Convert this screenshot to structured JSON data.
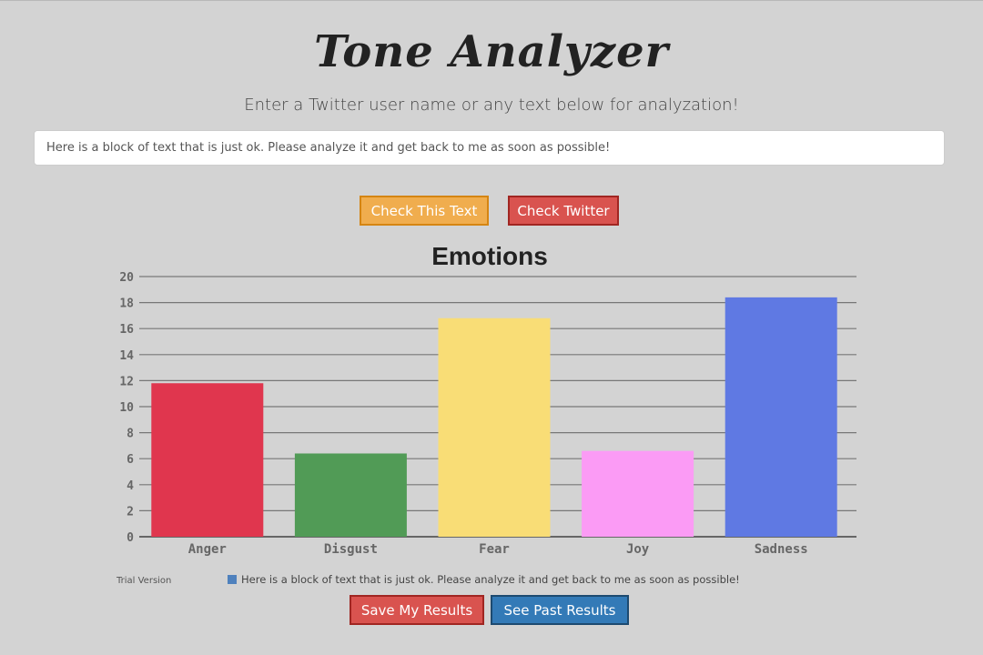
{
  "header": {
    "title": "Tone Analyzer",
    "subtitle": "Enter a Twitter user name or any text below for analyzation!"
  },
  "input": {
    "value": "Here is a block of text that is just ok. Please analyze it and get back to me as soon as possible!"
  },
  "buttons": {
    "check_text": "Check This Text",
    "check_twitter": "Check Twitter",
    "save": "Save My Results",
    "past": "See Past Results"
  },
  "footer": {
    "trial": "Trial Version",
    "legend_color": "#4f81bd"
  },
  "chart_data": {
    "type": "bar",
    "title": "Emotions",
    "categories": [
      "Anger",
      "Disgust",
      "Fear",
      "Joy",
      "Sadness"
    ],
    "series": [
      {
        "name": "Here is a block of text that is just ok. Please analyze it and get back to me as soon as possible!",
        "values": [
          11.8,
          6.4,
          16.8,
          6.6,
          18.4
        ]
      }
    ],
    "colors": [
      "#e0364e",
      "#519b56",
      "#f9dd76",
      "#fb9bf5",
      "#5f79e3"
    ],
    "ylim": [
      0,
      20
    ],
    "yticks": [
      0,
      2,
      4,
      6,
      8,
      10,
      12,
      14,
      16,
      18,
      20
    ],
    "grid": true,
    "legend": "bottom"
  }
}
